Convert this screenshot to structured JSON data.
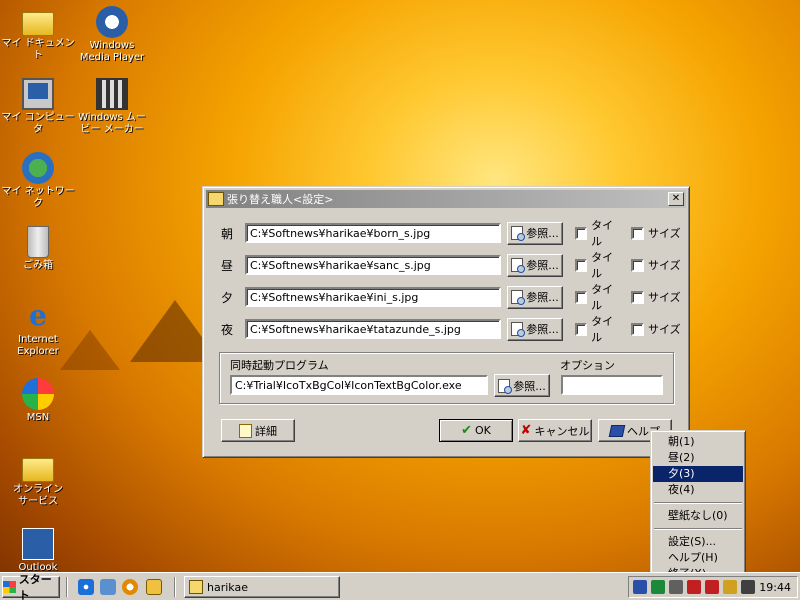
{
  "desktop": {
    "icons": [
      {
        "label": "マイ ドキュメント"
      },
      {
        "label": "Windows\nMedia Player"
      },
      {
        "label": "マイ コンピュータ"
      },
      {
        "label": "Windows ムー\nビー メーカー"
      },
      {
        "label": "マイ ネットワーク"
      },
      {
        "label": "ごみ箱"
      },
      {
        "label": "Internet\nExplorer"
      },
      {
        "label": "MSN"
      },
      {
        "label": "オンライン\nサービス"
      },
      {
        "label": "Outlook"
      }
    ]
  },
  "dialog": {
    "title": "張り替え職人<設定>",
    "close": "✕",
    "rows": [
      {
        "label": "朝",
        "path": "C:¥Softnews¥harikae¥born_s.jpg"
      },
      {
        "label": "昼",
        "path": "C:¥Softnews¥harikae¥sanc_s.jpg"
      },
      {
        "label": "夕",
        "path": "C:¥Softnews¥harikae¥ini_s.jpg"
      },
      {
        "label": "夜",
        "path": "C:¥Softnews¥harikae¥tatazunde_s.jpg"
      }
    ],
    "browse_label": "参照...",
    "tile_label": "タイル",
    "size_label": "サイズ",
    "startup": {
      "label": "同時起動プログラム",
      "path": "C:¥Trial¥IcoTxBgCol¥IconTextBgColor.exe",
      "option_label": "オプション",
      "option_value": ""
    },
    "buttons": {
      "detail": "詳細",
      "ok": "OK",
      "cancel": "キャンセル",
      "help": "ヘルプ"
    }
  },
  "context_menu": {
    "items": [
      "朝(1)",
      "昼(2)",
      "夕(3)",
      "夜(4)"
    ],
    "selected_index": 2,
    "no_wallpaper": "壁紙なし(0)",
    "settings": "設定(S)...",
    "help": "ヘルプ(H)",
    "exit": "終了(X)"
  },
  "taskbar": {
    "start": "スタート",
    "task": "harikae",
    "clock": "19:44"
  }
}
